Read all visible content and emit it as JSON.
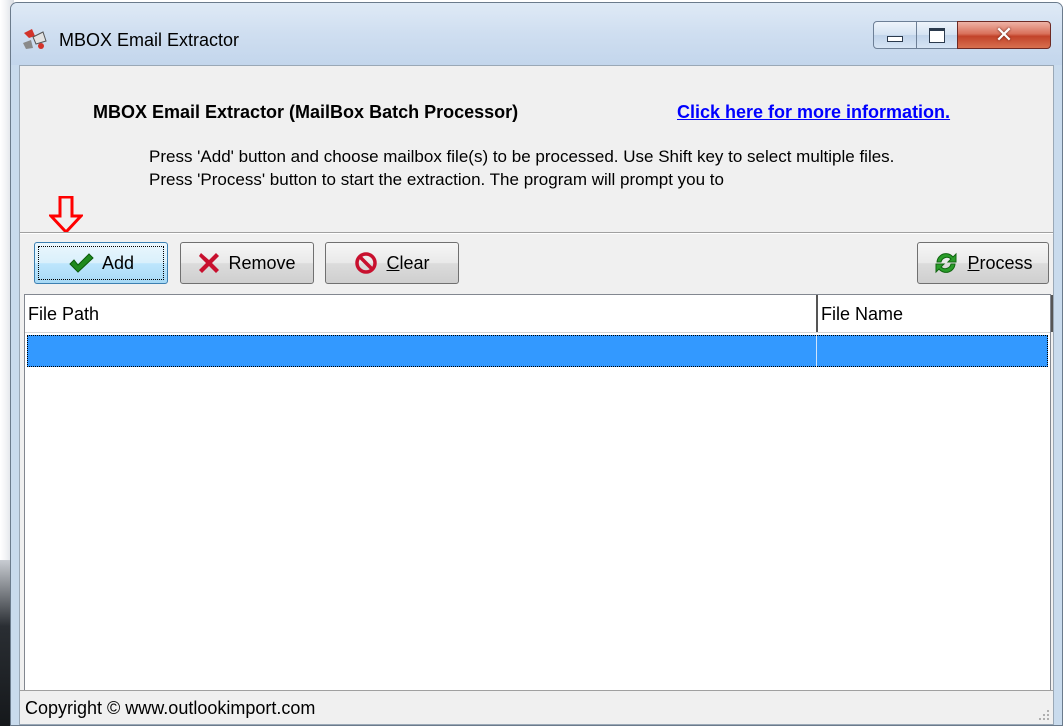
{
  "window": {
    "title": "MBOX Email Extractor",
    "controls": {
      "minimize": "minimize",
      "maximize": "maximize",
      "close": "close"
    }
  },
  "header": {
    "heading": "MBOX Email Extractor (MailBox Batch Processor)",
    "info_link": "Click here for more information.",
    "description": "Press 'Add' button and choose mailbox file(s) to be processed. Use Shift key to select multiple files. Press 'Process' button to start the extraction. The program will prompt you to"
  },
  "toolbar": {
    "add": {
      "label": "Add",
      "icon": "checkmark-icon"
    },
    "remove": {
      "label_underlined": "",
      "label_rest": "Remove",
      "icon": "x-icon"
    },
    "clear": {
      "label_underlined": "C",
      "label_rest": "lear",
      "icon": "no-sign-icon"
    },
    "process": {
      "label_underlined": "P",
      "label_rest": "rocess",
      "icon": "refresh-icon"
    }
  },
  "file_list": {
    "columns": [
      "File Path",
      "File Name"
    ],
    "rows": [
      {
        "path": "",
        "name": "",
        "selected": true
      }
    ]
  },
  "status_bar": {
    "text": "Copyright © www.outlookimport.com"
  },
  "colors": {
    "selection": "#3399ff",
    "link": "#0000ff",
    "annotation_arrow": "#ff0000",
    "close_button": "#c2432a"
  }
}
